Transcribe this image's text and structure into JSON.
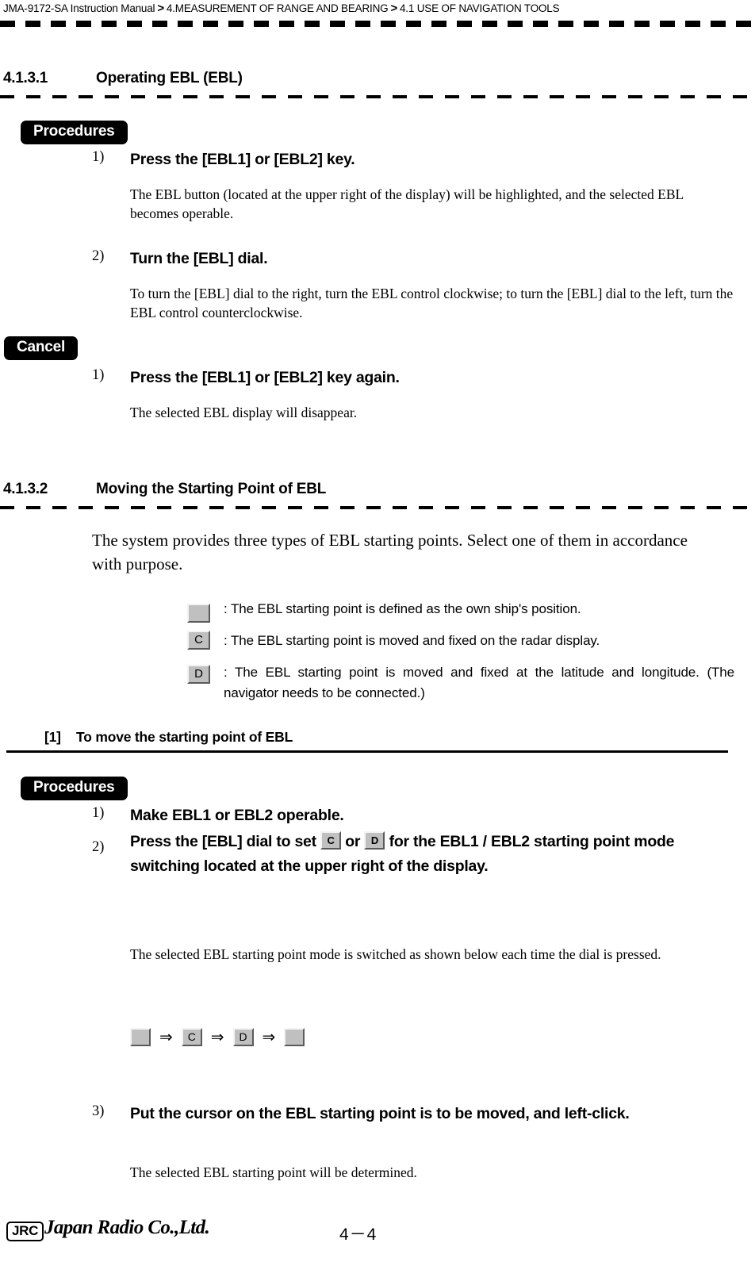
{
  "header": {
    "manual": "JMA-9172-SA Instruction Manual",
    "sep1": ">",
    "chapter": "4.MEASUREMENT OF RANGE AND BEARING",
    "sep2": ">",
    "section": "4.1  USE OF NAVIGATION TOOLS"
  },
  "section_1": {
    "number": "4.1.3.1",
    "title": "Operating EBL (EBL)",
    "badge_procedures": "Procedures",
    "badge_cancel": "Cancel",
    "steps": [
      {
        "num": "1)",
        "title": "Press the [EBL1] or [EBL2] key.",
        "body": "The  EBL  button (located at the upper right of the display) will be highlighted, and the selected EBL becomes operable."
      },
      {
        "num": "2)",
        "title": "Turn the [EBL] dial.",
        "body": "To turn the [EBL] dial to the right, turn the EBL control clockwise; to turn the [EBL] dial to the left, turn the EBL control counterclockwise."
      }
    ],
    "cancel_steps": [
      {
        "num": "1)",
        "title": "Press the [EBL1] or [EBL2] key again.",
        "body": "The selected EBL display will disappear."
      }
    ]
  },
  "section_2": {
    "number": "4.1.3.2",
    "title": "Moving the Starting Point of EBL",
    "intro": "The system provides three types of EBL starting points.  Select one of them in accordance with purpose.",
    "legend": [
      {
        "icon_label": "",
        "text": ": The EBL starting point is defined as the own ship's position."
      },
      {
        "icon_label": "C",
        "text": ": The EBL starting point is moved and fixed on the radar display."
      },
      {
        "icon_label": "D",
        "text": ": The EBL starting point is moved and fixed at the latitude and longitude. (The navigator needs to be connected.)"
      }
    ],
    "subheading": {
      "marker": "[1]",
      "text": "To move the starting point of EBL"
    },
    "badge_procedures": "Procedures",
    "steps": [
      {
        "num": "1)",
        "title": "Make EBL1 or EBL2 operable.",
        "body": ""
      },
      {
        "num": "2)",
        "title_part1": " Press the [EBL] dial to set ",
        "btn1": "C",
        "title_mid": " or ",
        "btn2": "D",
        "title_part2": " for the EBL1 / EBL2 starting point mode switching located at the upper right of the display.",
        "body": "The selected EBL starting point mode is switched as shown below each time the dial is pressed."
      },
      {
        "num": "3)",
        "title": "Put the cursor on the EBL starting point is to be moved, and left-click.",
        "body": "The selected EBL starting point will be determined."
      }
    ],
    "sequence": {
      "item1": "",
      "arrow1": "⇒",
      "item2": "C",
      "arrow2": "⇒",
      "item3": "D",
      "arrow3": "⇒",
      "item4": ""
    }
  },
  "footer": {
    "logo_text": "JRC",
    "company": "Japan Radio Co.,Ltd.",
    "page": "4－4"
  }
}
